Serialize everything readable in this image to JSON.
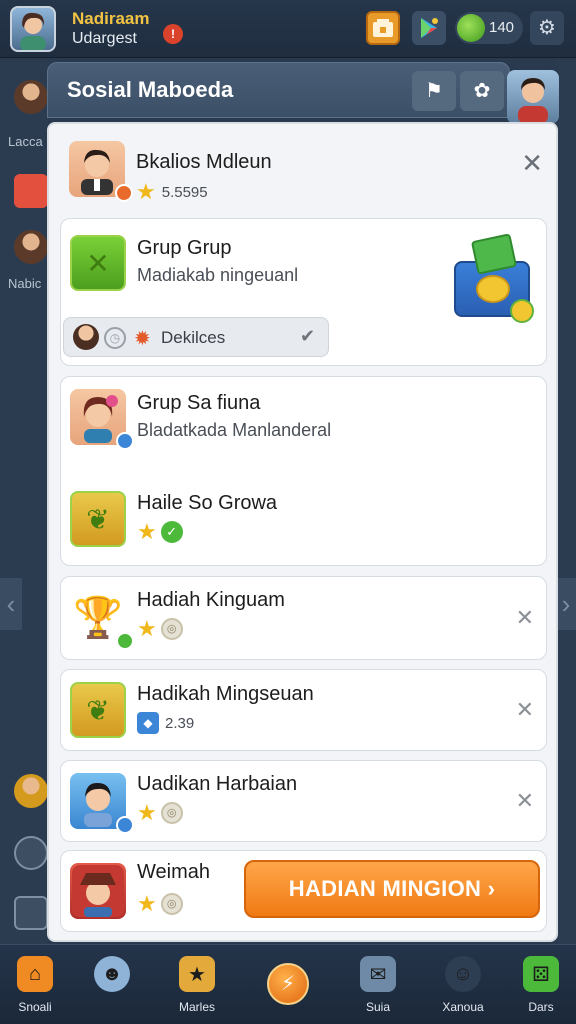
{
  "topbar": {
    "name": "Nadiraam",
    "subtitle": "Udargest",
    "badge": "!",
    "coins": "140"
  },
  "side": {
    "labels": [
      "Lacca",
      "Nabic"
    ]
  },
  "modal": {
    "title": "Sosial Maboeda"
  },
  "cards": [
    {
      "title": "Bkalios Mdleun",
      "meta": "5.5595"
    },
    {
      "title": "Grup Grup",
      "subtitle": "Madiakab ningeuanl",
      "pill_label": "Dekilces"
    },
    {
      "title": "Grup Sa fiuna",
      "subtitle": "Bladatkada Manlanderal",
      "title2": "Haile So Growa"
    },
    {
      "title": "Hadiah Kinguam"
    },
    {
      "title": "Hadikah Mingseuan",
      "meta": "2.39"
    },
    {
      "title": "Uadikan Harbaian"
    },
    {
      "title": "Weimah",
      "cta": "HADIAN MINGION ›"
    }
  ],
  "nav": [
    {
      "label": "Snoali"
    },
    {
      "label": ""
    },
    {
      "label": "Marles"
    },
    {
      "label": "Suia"
    },
    {
      "label": "Xanoua"
    },
    {
      "label": "Dars"
    }
  ],
  "colors": {
    "cta": "#f07a14",
    "accent_green": "#4cb93a",
    "gold": "#f0b81c",
    "header": "#3b4f67"
  }
}
